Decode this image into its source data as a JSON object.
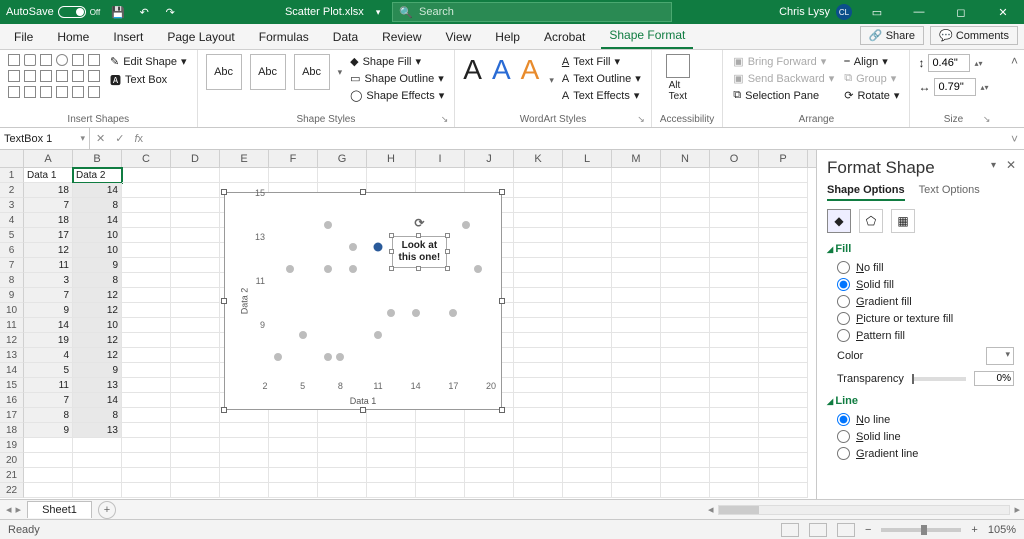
{
  "titlebar": {
    "autosave_label": "AutoSave",
    "autosave_state": "Off",
    "filename": "Scatter Plot.xlsx",
    "search_placeholder": "Search",
    "user_name": "Chris Lysy",
    "user_initials": "CL"
  },
  "tabs": {
    "items": [
      "File",
      "Home",
      "Insert",
      "Page Layout",
      "Formulas",
      "Data",
      "Review",
      "View",
      "Help",
      "Acrobat",
      "Shape Format"
    ],
    "active": "Shape Format",
    "share": "Share",
    "comments": "Comments"
  },
  "ribbon": {
    "insert_shapes": {
      "label": "Insert Shapes",
      "edit_shape": "Edit Shape",
      "text_box": "Text Box"
    },
    "shape_styles": {
      "label": "Shape Styles",
      "sample": "Abc",
      "fill": "Shape Fill",
      "outline": "Shape Outline",
      "effects": "Shape Effects"
    },
    "wordart": {
      "label": "WordArt Styles",
      "text_fill": "Text Fill",
      "text_outline": "Text Outline",
      "text_effects": "Text Effects"
    },
    "alt": {
      "label": "Accessibility",
      "button": "Alt\nText"
    },
    "arrange": {
      "label": "Arrange",
      "bring_forward": "Bring Forward",
      "send_backward": "Send Backward",
      "selection_pane": "Selection Pane",
      "align": "Align",
      "group": "Group",
      "rotate": "Rotate"
    },
    "size": {
      "label": "Size",
      "height": "0.46\"",
      "width": "0.79\""
    }
  },
  "namebox": "TextBox 1",
  "grid": {
    "columns": [
      "A",
      "B",
      "C",
      "D",
      "E",
      "F",
      "G",
      "H",
      "I",
      "J",
      "K",
      "L",
      "M",
      "N",
      "O",
      "P"
    ],
    "headers": [
      "Data 1",
      "Data 2"
    ],
    "rows": [
      [
        18,
        14
      ],
      [
        7,
        8
      ],
      [
        18,
        14
      ],
      [
        17,
        10
      ],
      [
        12,
        10
      ],
      [
        11,
        9
      ],
      [
        3,
        8
      ],
      [
        7,
        12
      ],
      [
        9,
        12
      ],
      [
        14,
        10
      ],
      [
        19,
        12
      ],
      [
        4,
        12
      ],
      [
        5,
        9
      ],
      [
        11,
        13
      ],
      [
        7,
        14
      ],
      [
        8,
        8
      ],
      [
        9,
        13
      ]
    ]
  },
  "chart_data": {
    "type": "scatter",
    "xlabel": "Data 1",
    "ylabel": "Data 2",
    "xlim": [
      2,
      20
    ],
    "ylim": [
      7,
      15
    ],
    "xticks": [
      2,
      5,
      8,
      11,
      14,
      17,
      20
    ],
    "yticks": [
      9,
      11,
      13,
      15
    ],
    "series": [
      {
        "name": "points",
        "points": [
          [
            18,
            14
          ],
          [
            7,
            8
          ],
          [
            17,
            10
          ],
          [
            12,
            10
          ],
          [
            11,
            9
          ],
          [
            3,
            8
          ],
          [
            7,
            12
          ],
          [
            9,
            12
          ],
          [
            14,
            10
          ],
          [
            19,
            12
          ],
          [
            4,
            12
          ],
          [
            5,
            9
          ],
          [
            7,
            14
          ],
          [
            8,
            8
          ],
          [
            9,
            13
          ]
        ]
      },
      {
        "name": "highlight",
        "points": [
          [
            11,
            13
          ]
        ]
      }
    ],
    "annotation": {
      "line1": "Look at",
      "line2": "this one!"
    }
  },
  "format_pane": {
    "title": "Format Shape",
    "tabs": [
      "Shape Options",
      "Text Options"
    ],
    "active_tab": "Shape Options",
    "fill": {
      "heading": "Fill",
      "options": [
        "No fill",
        "Solid fill",
        "Gradient fill",
        "Picture or texture fill",
        "Pattern fill"
      ],
      "selected": "Solid fill",
      "color_label": "Color",
      "transparency_label": "Transparency",
      "transparency_value": "0%"
    },
    "line": {
      "heading": "Line",
      "options": [
        "No line",
        "Solid line",
        "Gradient line"
      ],
      "selected": "No line"
    }
  },
  "sheet_tabs": {
    "active": "Sheet1"
  },
  "statusbar": {
    "mode": "Ready",
    "zoom": "105%"
  }
}
